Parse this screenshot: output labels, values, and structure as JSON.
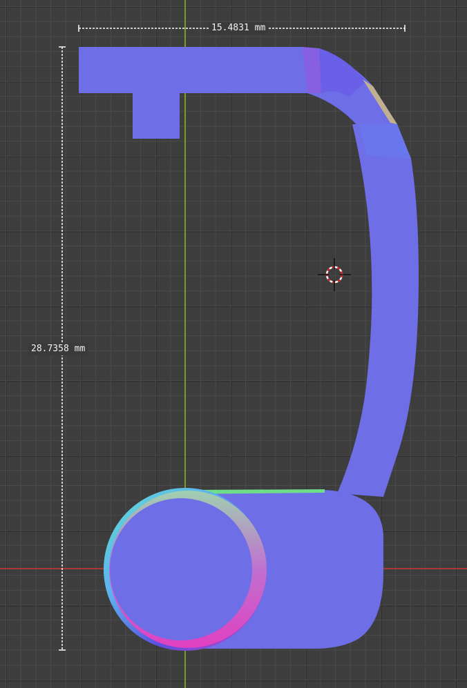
{
  "viewport": {
    "colors": {
      "background": "#3d3d3d",
      "grid": "#4a4a4a",
      "axis_y": "#7a9a2a",
      "axis_x": "#a83a3a",
      "model_face": "#6e6ee6",
      "measure_line": "#ffffff"
    }
  },
  "measurements": {
    "width_label": "15.4831 mm",
    "height_label": "28.7358 mm"
  },
  "cursor": {
    "icon": "3d-cursor-icon"
  }
}
